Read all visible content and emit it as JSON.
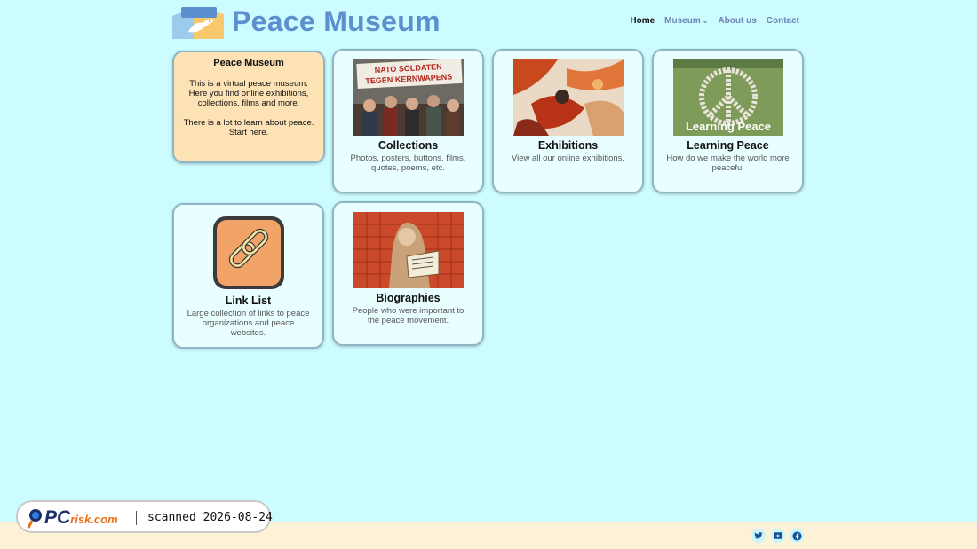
{
  "header": {
    "site_title": "Peace Museum",
    "nav": {
      "home": "Home",
      "museum": "Museum",
      "museum_caret": "⌄",
      "about": "About us",
      "contact": "Contact"
    }
  },
  "intro": {
    "title": "Peace Museum",
    "text1": "This is a virtual peace museum. Here you find online exhibitions, collections, films and more.",
    "text2": "There is a lot to learn about peace. Start here."
  },
  "cards": [
    {
      "title": "Collections",
      "desc": "Photos, posters, buttons, films, quotes, poems, etc.",
      "banner_line1": "NATO SOLDATEN",
      "banner_line2": "TEGEN KERNWAPENS"
    },
    {
      "title": "Exhibitions",
      "desc": "View all our online exhibitions."
    },
    {
      "title": "Learning Peace",
      "desc": "How do we make the world more peaceful",
      "image_caption": "Learning Peace"
    },
    {
      "title": "Link List",
      "desc": "Large collection of links to peace organizations and peace websites."
    },
    {
      "title": "Biographies",
      "desc": "People who were important to the peace movement."
    }
  ],
  "footer": {
    "social": [
      "twitter-icon",
      "youtube-icon",
      "facebook-icon"
    ]
  },
  "watermark": {
    "brand_pc": "PC",
    "brand_risk": "risk.com",
    "scan_text": "scanned 2026-08-24"
  },
  "colors": {
    "background": "#ccfcff",
    "title_blue": "#5b8fce",
    "intro_card": "#fde2b6",
    "card": "#e9feff",
    "footer": "#fdf1d8"
  }
}
